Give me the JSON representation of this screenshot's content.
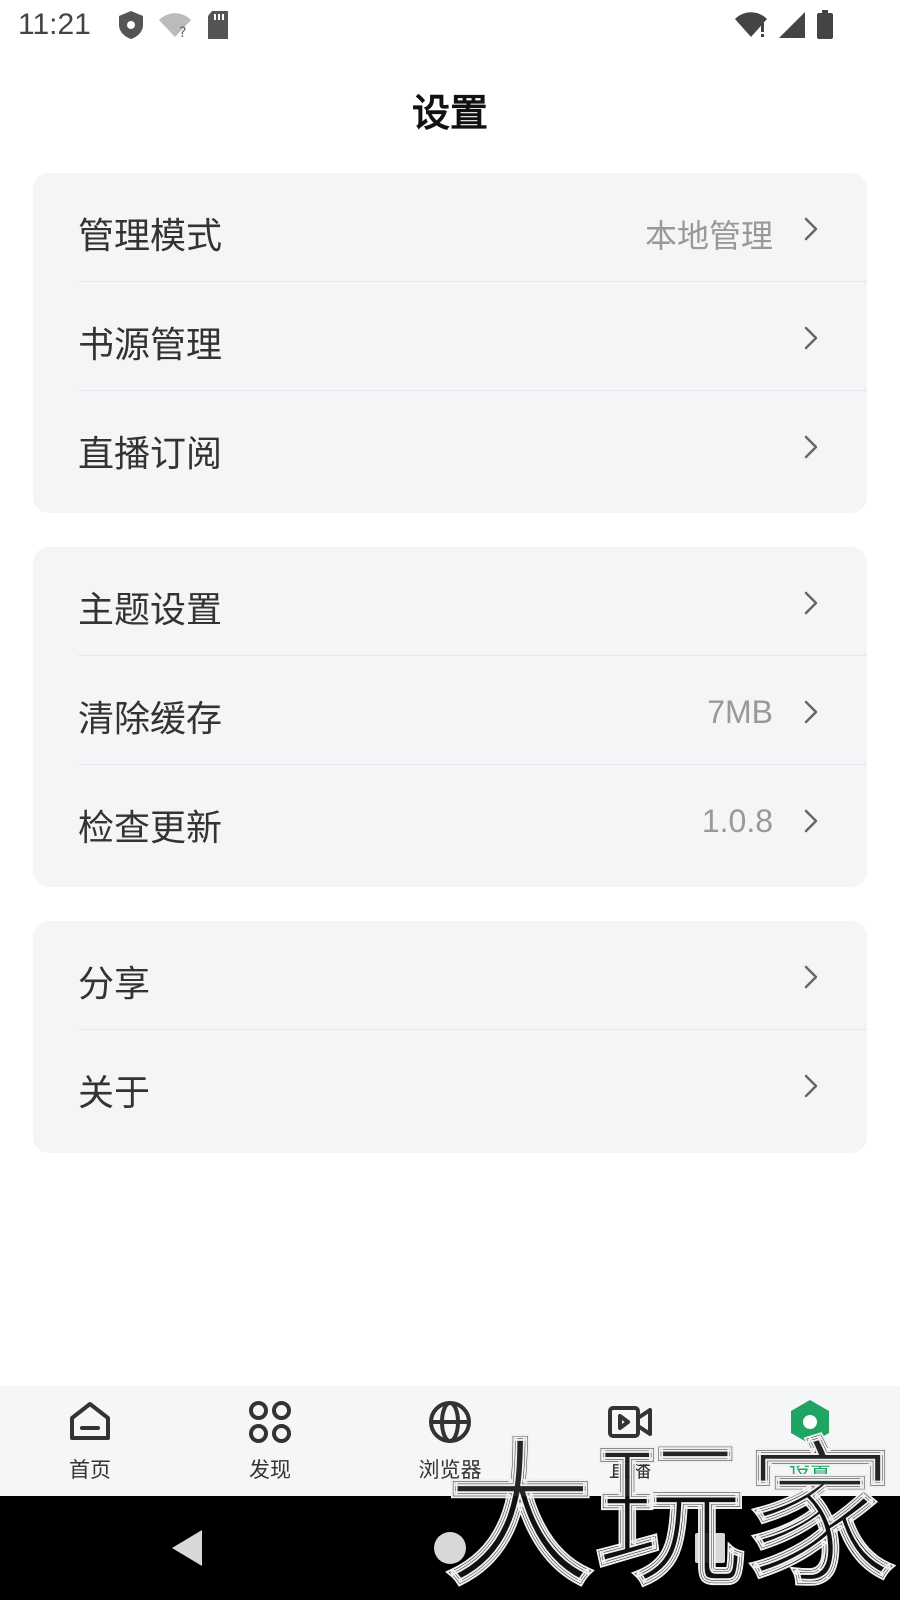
{
  "status_bar": {
    "time": "11:21",
    "left_icons": [
      "shield-icon",
      "wifi-question-icon",
      "sd-card-icon"
    ],
    "right_icons": [
      "wifi-alert-icon",
      "signal-icon",
      "battery-icon"
    ]
  },
  "page": {
    "title": "设置"
  },
  "groups": [
    {
      "rows": [
        {
          "label": "管理模式",
          "value": "本地管理"
        },
        {
          "label": "书源管理",
          "value": ""
        },
        {
          "label": "直播订阅",
          "value": ""
        }
      ]
    },
    {
      "rows": [
        {
          "label": "主题设置",
          "value": ""
        },
        {
          "label": "清除缓存",
          "value": "7MB"
        },
        {
          "label": "检查更新",
          "value": "1.0.8"
        }
      ]
    },
    {
      "rows": [
        {
          "label": "分享",
          "value": ""
        },
        {
          "label": "关于",
          "value": ""
        }
      ]
    }
  ],
  "bottom_nav": {
    "items": [
      {
        "label": "首页",
        "icon": "home-icon"
      },
      {
        "label": "发现",
        "icon": "discover-icon"
      },
      {
        "label": "浏览器",
        "icon": "globe-icon"
      },
      {
        "label": "直播",
        "icon": "video-icon"
      },
      {
        "label": "设置",
        "icon": "settings-hex-icon"
      }
    ],
    "active_index": 4
  },
  "watermark": {
    "text": "大玩家"
  },
  "colors": {
    "accent": "#1fa463",
    "card_bg": "#f4f5f7",
    "nav_bg": "#f5f6f8"
  }
}
